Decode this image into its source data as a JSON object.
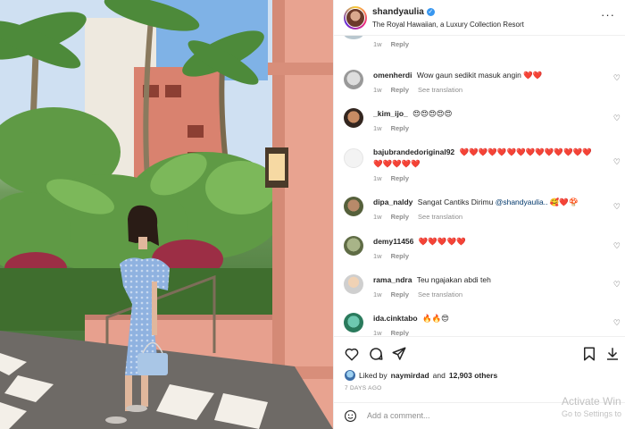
{
  "post": {
    "username": "shandyaulia",
    "location": "The Royal Hawaiian, a Luxury Collection Resort",
    "more_icon": "more-horizontal-icon"
  },
  "comments": [
    {
      "username": "",
      "text": "",
      "time": "1w",
      "reply": "Reply",
      "translate": ""
    },
    {
      "username": "omenherdi",
      "text": "Wow gaun sedikit masuk angin ❤️❤️",
      "time": "1w",
      "reply": "Reply",
      "translate": "See translation"
    },
    {
      "username": "_kim_ijo_",
      "text": "😍😍😍😍😍",
      "time": "1w",
      "reply": "Reply",
      "translate": ""
    },
    {
      "username": "bajubrandedoriginal92",
      "text": "❤️❤️❤️❤️❤️❤️❤️❤️❤️❤️❤️❤️❤️❤️❤️❤️❤️❤️❤️",
      "time": "1w",
      "reply": "Reply",
      "translate": ""
    },
    {
      "username": "dipa_naldy",
      "text": "Sangat Cantiks Dirimu",
      "mention": "@shandyaulia..",
      "extra": "🥰❤️🍄",
      "time": "1w",
      "reply": "Reply",
      "translate": "See translation"
    },
    {
      "username": "demy11456",
      "text": "❤️❤️❤️❤️❤️",
      "time": "1w",
      "reply": "Reply",
      "translate": ""
    },
    {
      "username": "rama_ndra",
      "text": "Teu ngajakan abdi teh",
      "time": "1w",
      "reply": "Reply",
      "translate": "See translation"
    },
    {
      "username": "ida.cinktabo",
      "text": "🔥🔥😍",
      "time": "1w",
      "reply": "Reply",
      "translate": ""
    }
  ],
  "likes": {
    "prefix": "Liked by",
    "user": "naymirdad",
    "joiner": "and",
    "count": "12,903 others"
  },
  "date": "7 DAYS AGO",
  "add_comment_placeholder": "Add a comment...",
  "watermark": {
    "line1": "Activate Win",
    "line2": "Go to Settings to"
  },
  "icons": [
    "heart-icon",
    "comment-icon",
    "share-icon",
    "bookmark-icon",
    "download-icon",
    "emoji-icon"
  ]
}
